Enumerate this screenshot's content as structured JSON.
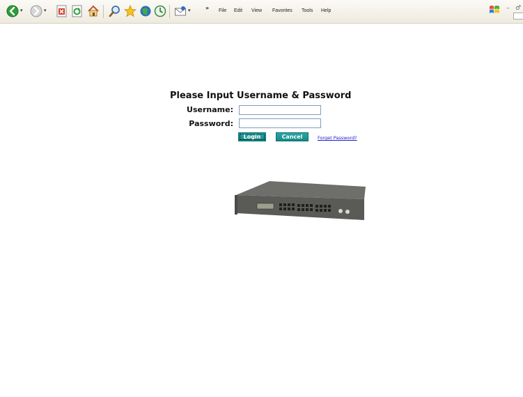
{
  "toolbar": {
    "buttons": [
      {
        "name": "back-icon"
      },
      {
        "name": "forward-icon"
      },
      {
        "name": "stop-icon"
      },
      {
        "name": "refresh-icon"
      },
      {
        "name": "home-icon"
      },
      {
        "name": "search-icon"
      },
      {
        "name": "favorites-star-icon"
      },
      {
        "name": "media-icon"
      },
      {
        "name": "history-icon"
      },
      {
        "name": "mail-icon"
      }
    ],
    "chevron": "»",
    "menus": [
      "File",
      "Edit",
      "View",
      "Favorites",
      "Tools",
      "Help"
    ],
    "window_controls": {
      "minimize": "–",
      "restore": "♂"
    }
  },
  "login": {
    "title": "Please Input Username & Password",
    "username_label": "Username:",
    "password_label": "Password:",
    "username_value": "",
    "password_value": "",
    "login_button": "Login",
    "cancel_button": "Cancel",
    "forget_link": "Forget Password?"
  },
  "image": {
    "name": "network-switch-image"
  },
  "colors": {
    "button": "#1a9896",
    "link": "#1a1acc",
    "toolbar": "#f3f1ea"
  }
}
